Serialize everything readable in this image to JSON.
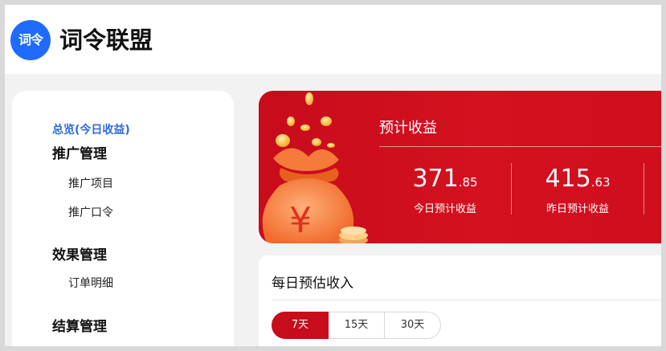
{
  "header": {
    "logo_text": "词令",
    "title": "词令联盟"
  },
  "sidebar": {
    "overview": "总览(今日收益)",
    "groups": [
      {
        "label": "推广管理",
        "items": [
          "推广项目",
          "推广口令"
        ]
      },
      {
        "label": "效果管理",
        "items": [
          "订单明细"
        ]
      },
      {
        "label": "结算管理",
        "items": []
      }
    ]
  },
  "banner": {
    "title": "预计收益",
    "currency_symbol": "¥",
    "stats": [
      {
        "int": "371",
        "dec": ".85",
        "label": "今日预计收益"
      },
      {
        "int": "415",
        "dec": ".63",
        "label": "昨日预计收益"
      }
    ]
  },
  "daily": {
    "title": "每日预估收入",
    "ranges": [
      "7天",
      "15天",
      "30天"
    ],
    "active_range": "7天"
  },
  "colors": {
    "brand_blue": "#1f6bff",
    "accent_red": "#c70c1c",
    "link_blue": "#2f6bd9"
  }
}
